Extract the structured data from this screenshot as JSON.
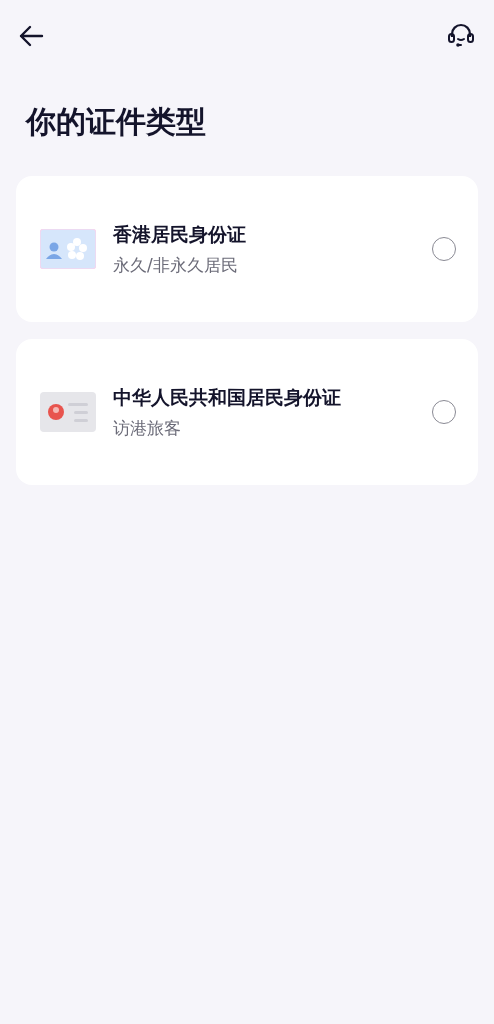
{
  "title": "你的证件类型",
  "options": [
    {
      "kind": "hk-card",
      "name": "香港居民身份证",
      "subtitle": "永久/非永久居民",
      "selected": false
    },
    {
      "kind": "cn-card",
      "name": "中华人民共和国居民身份证",
      "subtitle": "访港旅客",
      "selected": false
    }
  ]
}
